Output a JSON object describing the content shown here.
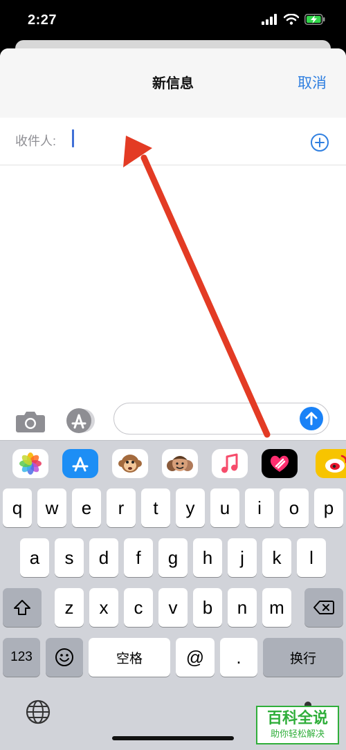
{
  "status_bar": {
    "time": "2:27"
  },
  "header": {
    "title": "新信息",
    "cancel_label": "取消"
  },
  "recipient": {
    "label": "收件人:"
  },
  "keyboard": {
    "row1": [
      "q",
      "w",
      "e",
      "r",
      "t",
      "y",
      "u",
      "i",
      "o",
      "p"
    ],
    "row2": [
      "a",
      "s",
      "d",
      "f",
      "g",
      "h",
      "j",
      "k",
      "l"
    ],
    "row3": [
      "z",
      "x",
      "c",
      "v",
      "b",
      "n",
      "m"
    ],
    "numbers_label": "123",
    "space_label": "空格",
    "at_label": "@",
    "dot_label": ".",
    "return_label": "换行"
  },
  "watermark": {
    "title": "百科全说",
    "subtitle": "助你轻松解决"
  },
  "colors": {
    "accent": "#2f7fe0",
    "send": "#1a82f7",
    "arrow": "#e33b24",
    "watermark": "#2fae3a"
  }
}
